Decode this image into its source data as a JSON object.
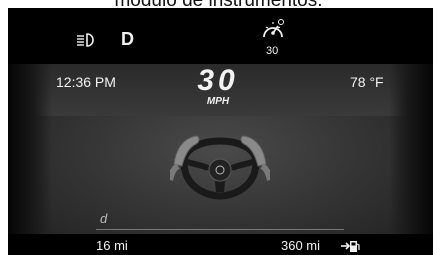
{
  "caption": "módulo de instrumentos.",
  "indicators": {
    "headlight_icon": "headlight-icon",
    "gear": "D",
    "cruise_icon": "cruise-control-icon",
    "cruise_speed": "30"
  },
  "info_bar": {
    "time": "12:36 PM",
    "temperature": "78 °F"
  },
  "speedometer": {
    "speed": "30",
    "unit": "MPH"
  },
  "center_graphic": "hands-on-wheel-icon",
  "drive_mode": "d",
  "bottom_bar": {
    "trip": "16  mi",
    "range": "360 mi",
    "fuel_icon": "fuel-range-icon"
  },
  "colors": {
    "display_bg": "#000000",
    "screen_mid": "#3a3a3a",
    "text": "#f2f2f2"
  }
}
